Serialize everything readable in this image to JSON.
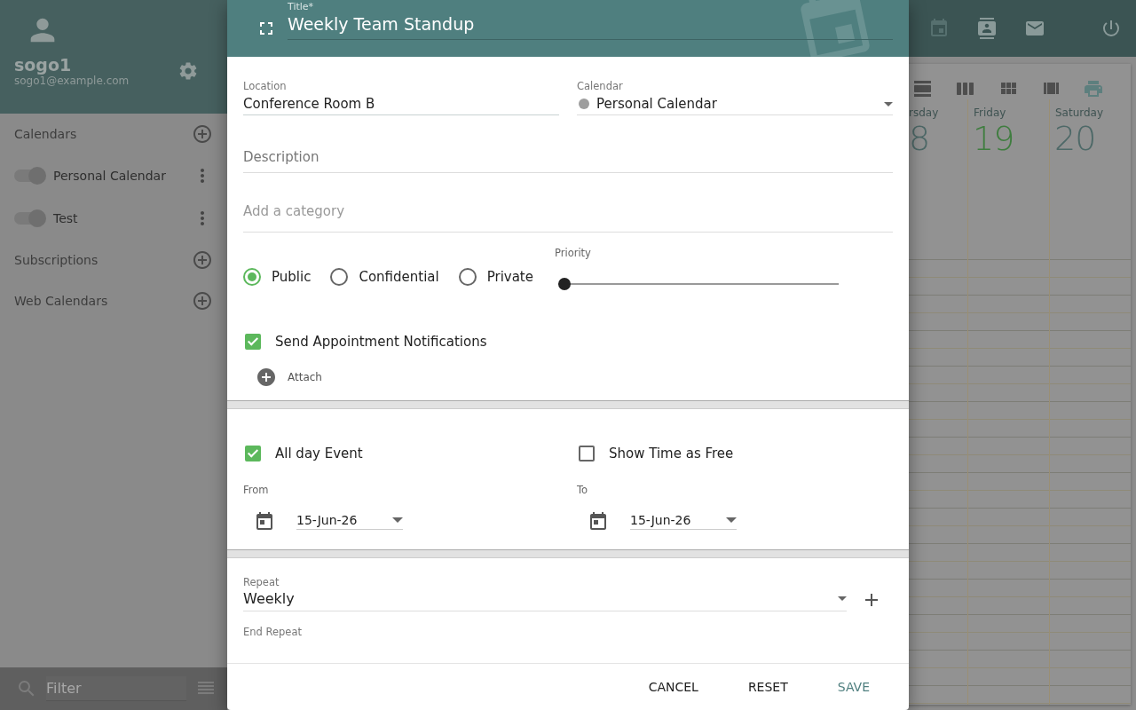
{
  "sidebar": {
    "user": {
      "name": "sogo1",
      "email": "sogo1@example.com"
    },
    "sections": [
      {
        "label": "Calendars",
        "calendars": [
          {
            "name": "Personal Calendar",
            "on": true
          },
          {
            "name": "Test",
            "on": true
          }
        ]
      },
      {
        "label": "Subscriptions"
      },
      {
        "label": "Web Calendars"
      }
    ],
    "filter": {
      "placeholder": "Filter"
    }
  },
  "calendar_view": {
    "days": [
      {
        "name": "rsday",
        "date": "8",
        "today": false
      },
      {
        "name": "Friday",
        "date": "19",
        "today": true
      },
      {
        "name": "Saturday",
        "date": "20",
        "today": false
      }
    ]
  },
  "dialog": {
    "title_field": {
      "label": "Title*",
      "value": "Weekly Team Standup"
    },
    "location": {
      "label": "Location",
      "value": "Conference Room B"
    },
    "calendar": {
      "label": "Calendar",
      "value": "Personal Calendar"
    },
    "description": {
      "placeholder": "Description"
    },
    "category": {
      "placeholder": "Add a category"
    },
    "privacy": [
      {
        "label": "Public",
        "selected": true
      },
      {
        "label": "Confidential",
        "selected": false
      },
      {
        "label": "Private",
        "selected": false
      }
    ],
    "priority": {
      "label": "Priority",
      "level": 0
    },
    "notifications": {
      "label": "Send Appointment Notifications",
      "checked": true
    },
    "attach": {
      "label": "Attach"
    },
    "all_day": {
      "label": "All day Event",
      "checked": true
    },
    "show_free": {
      "label": "Show Time as Free",
      "checked": false
    },
    "from": {
      "label": "From",
      "value": "15-Jun-26"
    },
    "to": {
      "label": "To",
      "value": "15-Jun-26"
    },
    "repeat": {
      "label": "Repeat",
      "value": "Weekly"
    },
    "end_repeat": {
      "label": "End Repeat"
    },
    "buttons": [
      {
        "label": "CANCEL",
        "primary": false
      },
      {
        "label": "RESET",
        "primary": false
      },
      {
        "label": "SAVE",
        "primary": true
      }
    ]
  }
}
